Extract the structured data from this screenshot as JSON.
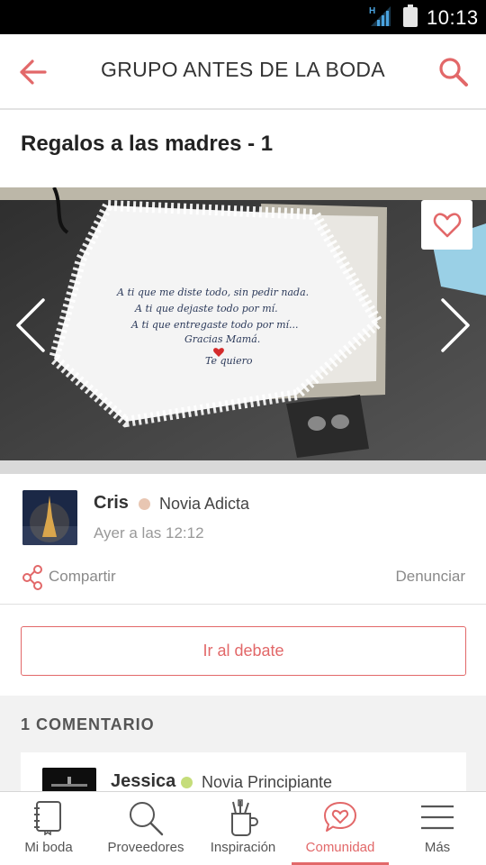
{
  "status_bar": {
    "time": "10:13",
    "network_type": "H"
  },
  "header": {
    "title": "GRUPO ANTES DE LA BODA",
    "back_icon": "back-arrow-icon",
    "search_icon": "search-icon",
    "accent_color": "#e26869"
  },
  "post": {
    "title": "Regalos a las madres - 1",
    "photo_text": [
      "A ti que me diste todo, sin pedir nada.",
      "A ti que dejaste todo por mí.",
      "A ti que entregaste todo por mí...",
      "Gracias Mamá.",
      "Te quiero"
    ],
    "author": {
      "name": "Cris",
      "rank": "Novia Adicta",
      "rank_color": "#e8c6b2"
    },
    "date": "Ayer a las 12:12",
    "share_label": "Compartir",
    "report_label": "Denunciar",
    "debate_button": "Ir al debate"
  },
  "comments": {
    "heading": "1 COMENTARIO",
    "items": [
      {
        "author": "Jessica",
        "rank": "Novia Principiante",
        "rank_color": "#c5dd7a"
      }
    ]
  },
  "bottom_nav": {
    "items": [
      {
        "label": "Mi boda",
        "icon": "notebook-icon"
      },
      {
        "label": "Proveedores",
        "icon": "search-icon"
      },
      {
        "label": "Inspiración",
        "icon": "tools-cup-icon"
      },
      {
        "label": "Comunidad",
        "icon": "heart-chat-icon",
        "active": true
      },
      {
        "label": "Más",
        "icon": "menu-icon"
      }
    ]
  }
}
